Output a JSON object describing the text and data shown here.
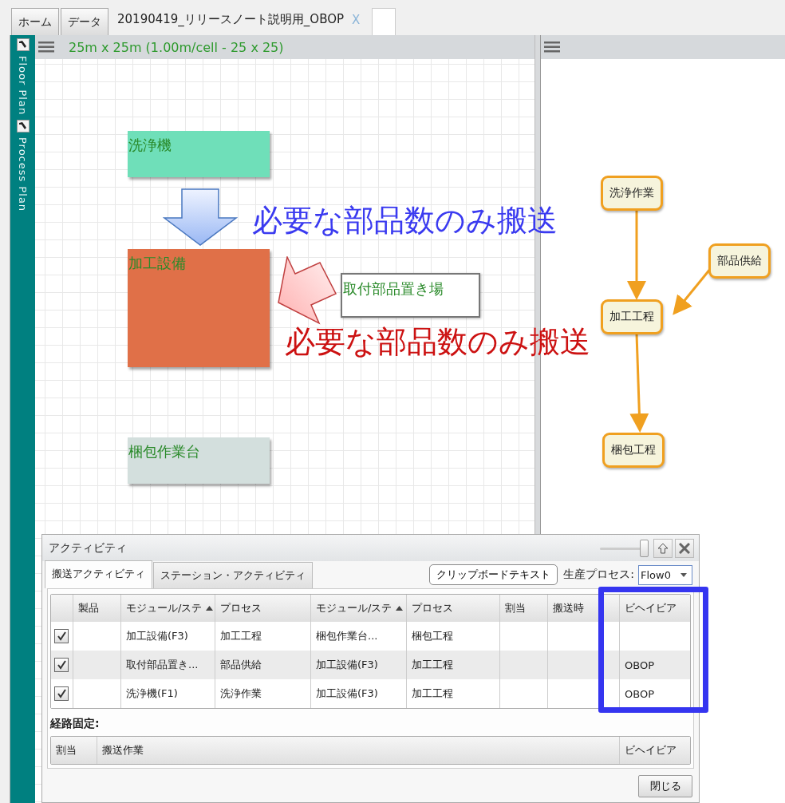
{
  "document_tabs": [
    {
      "label": "ホーム",
      "selected": false
    },
    {
      "label": "データ",
      "selected": false
    },
    {
      "label": "20190419_リリースノート説明用_OBOP",
      "selected": true,
      "close": "X"
    }
  ],
  "side_tabs": [
    {
      "label": "Floor Plan"
    },
    {
      "label": "Process Plan"
    }
  ],
  "floor_plan": {
    "header": "25m x 25m (1.00m/cell - 25 x 25)",
    "modules": [
      {
        "label": "洗浄機",
        "kind": "filled",
        "color": "#6fdfb9"
      },
      {
        "label": "加工設備",
        "kind": "filled",
        "color": "#e07048"
      },
      {
        "label": "取付部品置き場",
        "kind": "outline",
        "color": "#ffffff"
      },
      {
        "label": "梱包作業台",
        "kind": "filled",
        "color": "#d3dfdd"
      }
    ],
    "callouts": [
      {
        "text": "必要な部品数のみ搬送",
        "color": "#3a3af0"
      },
      {
        "text": "必要な部品数のみ搬送",
        "color": "#cc1111"
      }
    ]
  },
  "process_plan": {
    "nodes": [
      {
        "label": "洗浄作業"
      },
      {
        "label": "部品供給"
      },
      {
        "label": "加工工程"
      },
      {
        "label": "梱包工程"
      }
    ]
  },
  "activity_dialog": {
    "title": "アクティビティ",
    "zoom_slider": {
      "level": 1
    },
    "tabs": [
      {
        "label": "搬送アクティビティ",
        "selected": true
      },
      {
        "label": "ステーション・アクティビティ",
        "selected": false
      }
    ],
    "clipboard_button": "クリップボードテキスト",
    "process_label": "生産プロセス:",
    "process_value": "Flow0",
    "columns": [
      {
        "sorted": false
      },
      {
        "label": "製品",
        "sorted": false
      },
      {
        "label": "モジュール/ステ",
        "sorted": true
      },
      {
        "label": "プロセス",
        "sorted": false
      },
      {
        "label": "モジュール/ステ",
        "sorted": true
      },
      {
        "label": "プロセス",
        "sorted": false
      },
      {
        "label": "割当",
        "sorted": false
      },
      {
        "label": "搬送時",
        "sorted": false
      },
      {
        "label": "ビヘイビア",
        "sorted": false
      }
    ],
    "rows": [
      {
        "checked": true,
        "cells": [
          "",
          "",
          "加工設備(F3)",
          "加工工程",
          "梱包作業台...",
          "梱包工程",
          "",
          "",
          ""
        ]
      },
      {
        "checked": true,
        "cells": [
          "",
          "",
          "取付部品置き...",
          "部品供給",
          "加工設備(F3)",
          "加工工程",
          "",
          "",
          "OBOP"
        ]
      },
      {
        "checked": true,
        "cells": [
          "",
          "",
          "洗浄機(F1)",
          "洗浄作業",
          "加工設備(F3)",
          "加工工程",
          "",
          "",
          "OBOP"
        ]
      }
    ],
    "route_label": "経路固定:",
    "route_columns": [
      "割当",
      "搬送作業",
      "ビヘイビア"
    ],
    "close_button": "閉じる"
  }
}
